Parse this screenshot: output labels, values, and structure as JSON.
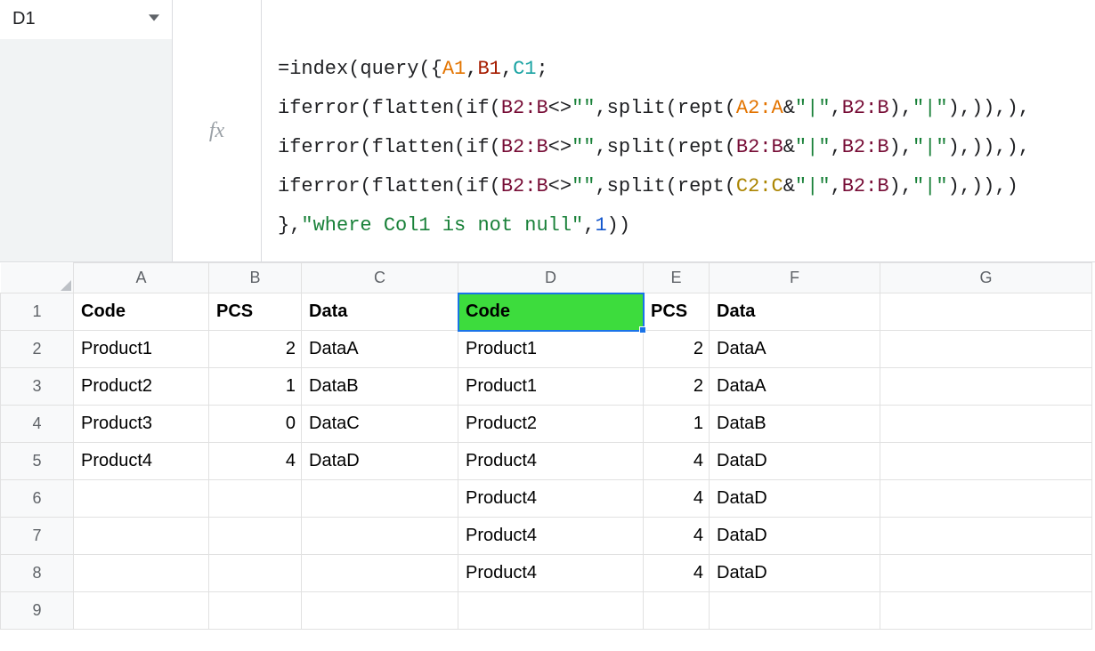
{
  "namebox": {
    "value": "D1"
  },
  "formula": {
    "line1_prefix": "=index(query({",
    "line1_a1": "A1",
    "line1_b1": "B1",
    "line1_c1": "C1",
    "line1_suffix": ";",
    "l2_a": "iferror(flatten(if(",
    "l2_r1": "B2:B",
    "l2_b": "<>",
    "l2_empty": "\"\"",
    "l2_c": ",split(rept(",
    "l2_r2": "A2:A",
    "l2_amp": "&",
    "l2_pipe": "\"|\"",
    "l2_comma1": ",",
    "l2_r3": "B2:B",
    "l2_close": "),",
    "l2_pipe2": "\"|\"",
    "l2_tail": "),)),),",
    "l3_a": "iferror(flatten(if(",
    "l3_r1": "B2:B",
    "l3_b": "<>",
    "l3_empty": "\"\"",
    "l3_c": ",split(rept(",
    "l3_r2": "B2:B",
    "l3_amp": "&",
    "l3_pipe": "\"|\"",
    "l3_comma1": ",",
    "l3_r3": "B2:B",
    "l3_close": "),",
    "l3_pipe2": "\"|\"",
    "l3_tail": "),)),),",
    "l4_a": "iferror(flatten(if(",
    "l4_r1": "B2:B",
    "l4_b": "<>",
    "l4_empty": "\"\"",
    "l4_c": ",split(rept(",
    "l4_r2": "C2:C",
    "l4_amp": "&",
    "l4_pipe": "\"|\"",
    "l4_comma1": ",",
    "l4_r3": "B2:B",
    "l4_close": "),",
    "l4_pipe2": "\"|\"",
    "l4_tail": "),)),)",
    "l5_open": "},",
    "l5_where": "\"where Col1 is not null\"",
    "l5_comma": ",",
    "l5_one": "1",
    "l5_close": "))"
  },
  "cols": {
    "A": "A",
    "B": "B",
    "C": "C",
    "D": "D",
    "E": "E",
    "F": "F",
    "G": "G"
  },
  "rowNums": {
    "1": "1",
    "2": "2",
    "3": "3",
    "4": "4",
    "5": "5",
    "6": "6",
    "7": "7",
    "8": "8",
    "9": "9"
  },
  "cells": {
    "A1": "Code",
    "B1": "PCS",
    "C1": "Data",
    "D1": "Code",
    "E1": "PCS",
    "F1": "Data",
    "A2": "Product1",
    "B2": "2",
    "C2": "DataA",
    "D2": "Product1",
    "E2": "2",
    "F2": "DataA",
    "A3": "Product2",
    "B3": "1",
    "C3": "DataB",
    "D3": "Product1",
    "E3": "2",
    "F3": "DataA",
    "A4": "Product3",
    "B4": "0",
    "C4": "DataC",
    "D4": "Product2",
    "E4": "1",
    "F4": "DataB",
    "A5": "Product4",
    "B5": "4",
    "C5": "DataD",
    "D5": "Product4",
    "E5": "4",
    "F5": "DataD",
    "D6": "Product4",
    "E6": "4",
    "F6": "DataD",
    "D7": "Product4",
    "E7": "4",
    "F7": "DataD",
    "D8": "Product4",
    "E8": "4",
    "F8": "DataD"
  }
}
